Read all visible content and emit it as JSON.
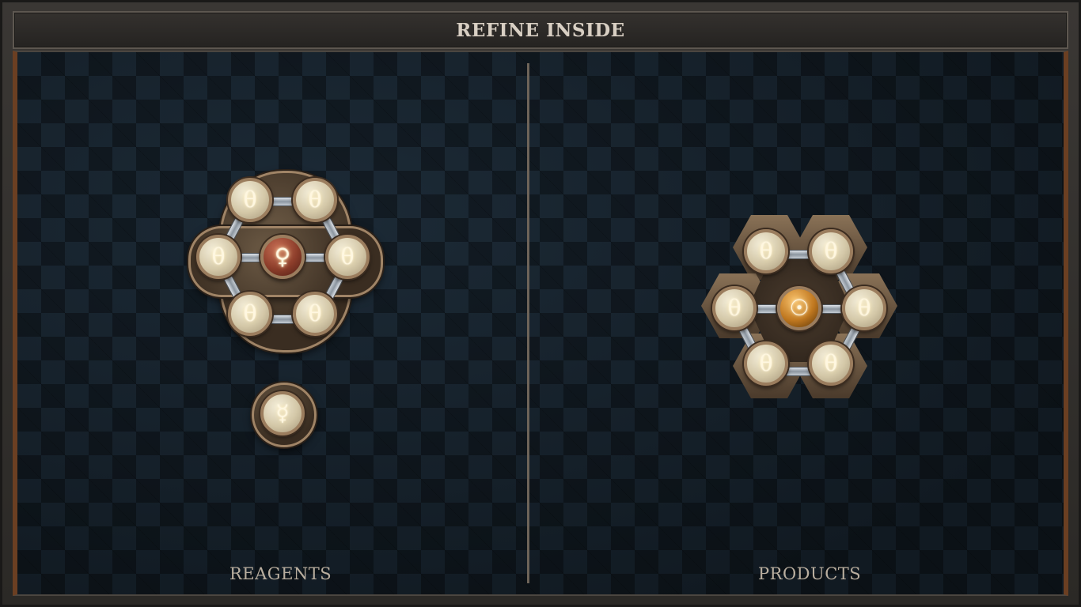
{
  "title": "REFINE INSIDE",
  "panels": {
    "left_label": "REAGENTS",
    "right_label": "PRODUCTS"
  },
  "reagents": {
    "molecule1": {
      "center": {
        "symbol": "♀",
        "element": "copper"
      },
      "ring": [
        "θ",
        "θ",
        "θ",
        "θ",
        "θ",
        "θ"
      ]
    },
    "molecule2": {
      "center": {
        "symbol": "☿",
        "element": "quicksilver"
      }
    }
  },
  "products": {
    "molecule1": {
      "center": {
        "symbol": "☉",
        "element": "gold"
      },
      "ring": [
        "θ",
        "θ",
        "θ",
        "θ",
        "θ",
        "θ"
      ]
    }
  }
}
